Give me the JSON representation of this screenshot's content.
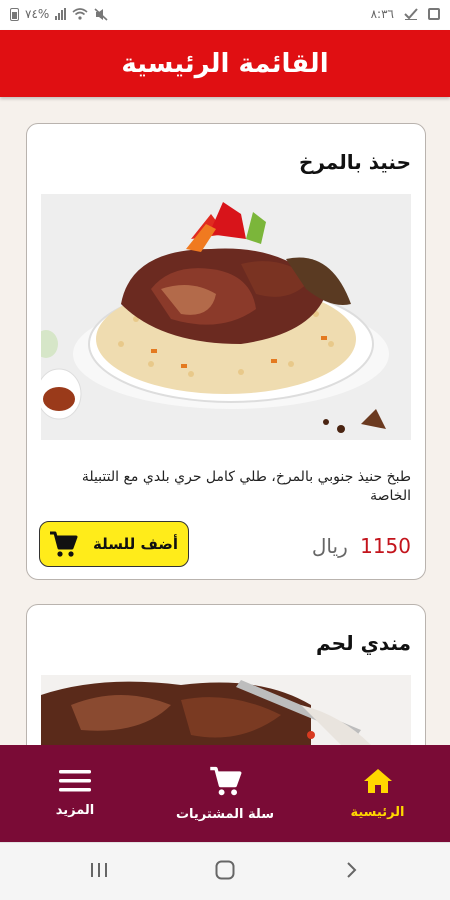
{
  "status_bar": {
    "battery": "٧٤%",
    "time": "٨:٣٦",
    "icons": [
      "battery-icon",
      "signal-icon",
      "wifi-icon",
      "mute-icon",
      "screenshot-icon",
      "check-icon"
    ]
  },
  "header": {
    "title": "القائمة الرئيسية"
  },
  "products": [
    {
      "name": "حنيذ بالمرخ",
      "description": "طبخ حنيذ جنوبي بالمرخ، طلي كامل حري بلدي مع التتبيلة الخاصة",
      "price": "1150",
      "currency": "ريال",
      "add_label": "أضف للسلة"
    },
    {
      "name": "مندي لحم"
    }
  ],
  "bottom_nav": {
    "home": "الرئيسية",
    "cart": "سلة المشتريات",
    "more": "المزيد"
  },
  "colors": {
    "header": "#e00f12",
    "bottom_nav": "#7a0b36",
    "active_tab": "#ffd800",
    "add_button": "#ffec1a",
    "price": "#c3141c"
  }
}
